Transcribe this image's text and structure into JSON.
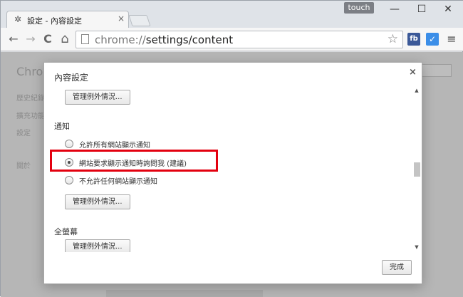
{
  "tab": {
    "title": "設定 - 內容設定",
    "icon": "gear-icon",
    "close": "×"
  },
  "window": {
    "touch_label": "touch",
    "minimize": "—",
    "maximize": "☐",
    "close": "✕"
  },
  "toolbar": {
    "back": "←",
    "forward": "→",
    "reload": "C",
    "home": "⌂",
    "url_scheme": "chrome://",
    "url_path": "settings/content",
    "star": "☆",
    "ext_fb": "fb",
    "ext_check": "✓",
    "menu": "≡"
  },
  "background": {
    "heading": "Chro",
    "nav_items": [
      "歷史紀錄",
      "擴充功能",
      "設定",
      "關於"
    ]
  },
  "dialog": {
    "title": "內容設定",
    "close": "×",
    "manage_exceptions_label": "管理例外情況...",
    "notifications": {
      "title": "通知",
      "options": [
        {
          "label": "允許所有網站顯示通知",
          "checked": false
        },
        {
          "label": "網站要求顯示通知時詢問我 (建議)",
          "checked": true
        },
        {
          "label": "不允許任何網站顯示通知",
          "checked": false
        }
      ]
    },
    "fullscreen": {
      "title": "全螢幕"
    },
    "done_label": "完成",
    "scroll_up": "▲",
    "scroll_down": "▼"
  },
  "colors": {
    "highlight": "#e3000f",
    "fb": "#3b5998",
    "check": "#3b8ee8"
  }
}
